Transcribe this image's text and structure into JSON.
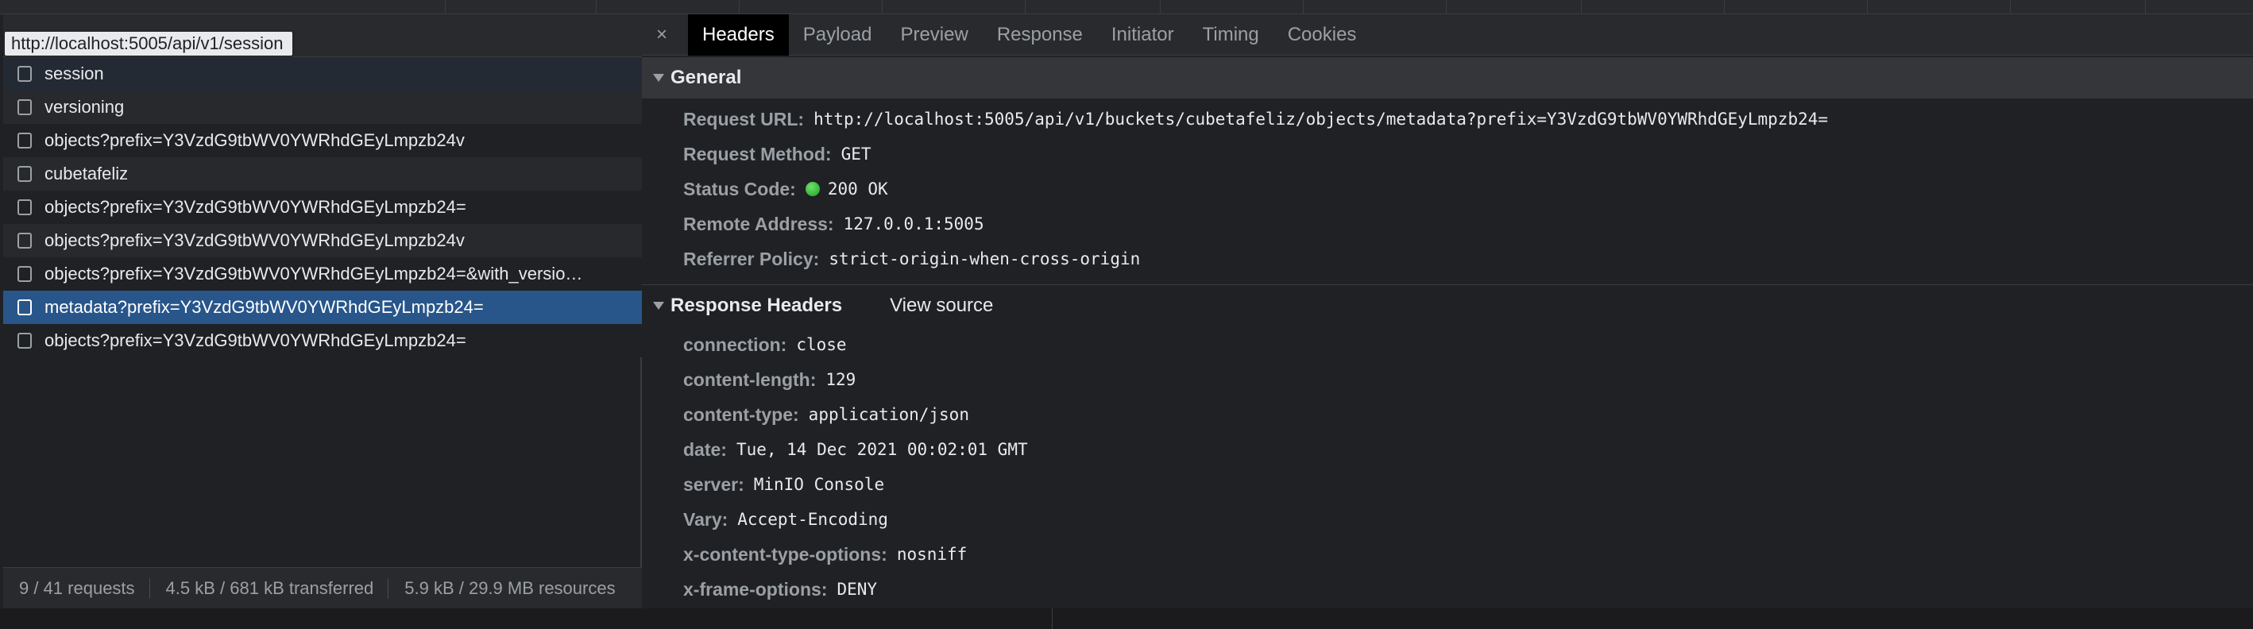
{
  "tooltip_url": "http://localhost:5005/api/v1/session",
  "requests": [
    {
      "name": "session"
    },
    {
      "name": "versioning"
    },
    {
      "name": "objects?prefix=Y3VzdG9tbWV0YWRhdGEyLmpzb24v"
    },
    {
      "name": "cubetafeliz"
    },
    {
      "name": "objects?prefix=Y3VzdG9tbWV0YWRhdGEyLmpzb24="
    },
    {
      "name": "objects?prefix=Y3VzdG9tbWV0YWRhdGEyLmpzb24v"
    },
    {
      "name": "objects?prefix=Y3VzdG9tbWV0YWRhdGEyLmpzb24=&with_versio…"
    },
    {
      "name": "metadata?prefix=Y3VzdG9tbWV0YWRhdGEyLmpzb24="
    },
    {
      "name": "objects?prefix=Y3VzdG9tbWV0YWRhdGEyLmpzb24="
    }
  ],
  "status": {
    "requests": "9 / 41 requests",
    "transferred": "4.5 kB / 681 kB transferred",
    "resources": "5.9 kB / 29.9 MB resources"
  },
  "tabs": {
    "close": "×",
    "headers": "Headers",
    "payload": "Payload",
    "preview": "Preview",
    "response": "Response",
    "initiator": "Initiator",
    "timing": "Timing",
    "cookies": "Cookies"
  },
  "general": {
    "title": "General",
    "request_url_label": "Request URL:",
    "request_url": "http://localhost:5005/api/v1/buckets/cubetafeliz/objects/metadata?prefix=Y3VzdG9tbWV0YWRhdGEyLmpzb24=",
    "request_method_label": "Request Method:",
    "request_method": "GET",
    "status_code_label": "Status Code:",
    "status_code": "200 OK",
    "remote_address_label": "Remote Address:",
    "remote_address": "127.0.0.1:5005",
    "referrer_policy_label": "Referrer Policy:",
    "referrer_policy": "strict-origin-when-cross-origin"
  },
  "response_headers": {
    "title": "Response Headers",
    "view_source": "View source",
    "items": [
      {
        "key": "connection:",
        "value": "close"
      },
      {
        "key": "content-length:",
        "value": "129"
      },
      {
        "key": "content-type:",
        "value": "application/json"
      },
      {
        "key": "date:",
        "value": "Tue, 14 Dec 2021 00:02:01 GMT"
      },
      {
        "key": "server:",
        "value": "MinIO Console"
      },
      {
        "key": "Vary:",
        "value": "Accept-Encoding"
      },
      {
        "key": "x-content-type-options:",
        "value": "nosniff"
      },
      {
        "key": "x-frame-options:",
        "value": "DENY"
      }
    ]
  },
  "colors": {
    "selected_row": "#28568a",
    "status_ok": "#34c334",
    "background": "#202124"
  }
}
